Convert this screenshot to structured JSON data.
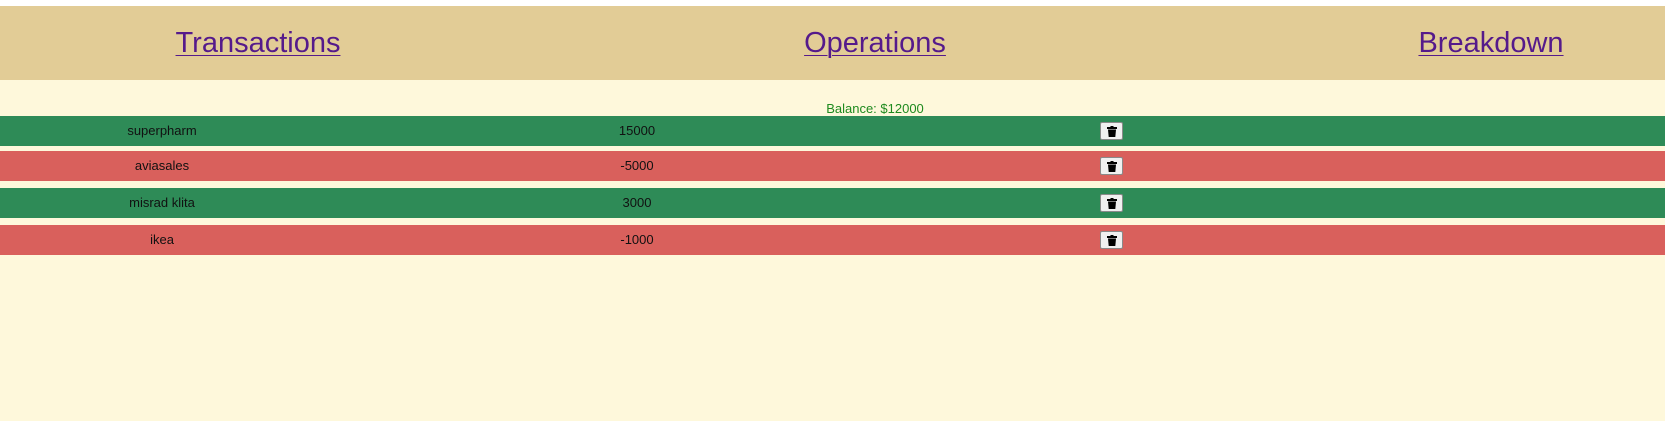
{
  "nav": {
    "links": [
      {
        "label": "Transactions"
      },
      {
        "label": "Operations"
      },
      {
        "label": "Breakdown"
      }
    ],
    "link_color": "#551a8b",
    "bar_color": "#e2cc96"
  },
  "summary": {
    "balance_text": "Balance: $12000",
    "balance_color": "#1e8a1e"
  },
  "transactions": [
    {
      "vendor": "superpharm",
      "amount": "15000",
      "type": "income",
      "delete_icon": "trash-icon"
    },
    {
      "vendor": "aviasales",
      "amount": "-5000",
      "type": "expense",
      "delete_icon": "trash-icon"
    },
    {
      "vendor": "misrad klita",
      "amount": "3000",
      "type": "income",
      "delete_icon": "trash-icon"
    },
    {
      "vendor": "ikea",
      "amount": "-1000",
      "type": "expense",
      "delete_icon": "trash-icon"
    }
  ],
  "colors": {
    "background": "#fef8db",
    "income_row": "#2e8b57",
    "expense_row": "#d9605c"
  }
}
